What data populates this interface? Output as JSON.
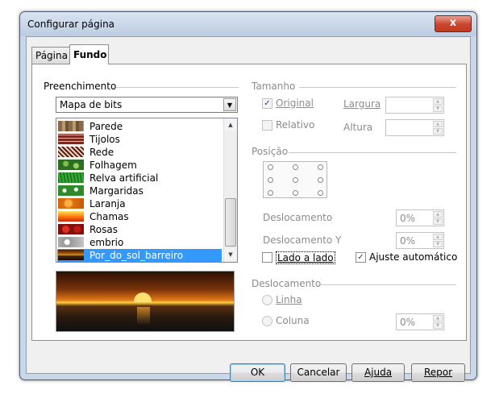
{
  "window": {
    "title": "Configurar página",
    "close_label": "x"
  },
  "tabs": [
    {
      "label": "Página",
      "active": false
    },
    {
      "label": "Fundo",
      "active": true
    }
  ],
  "fill": {
    "group_label": "Preenchimento",
    "type_selected": "Mapa de bits",
    "bitmaps": [
      {
        "name": "Parede",
        "selected": false
      },
      {
        "name": "Tijolos",
        "selected": false
      },
      {
        "name": "Rede",
        "selected": false
      },
      {
        "name": "Folhagem",
        "selected": false
      },
      {
        "name": "Relva artificial",
        "selected": false
      },
      {
        "name": "Margaridas",
        "selected": false
      },
      {
        "name": "Laranja",
        "selected": false
      },
      {
        "name": "Chamas",
        "selected": false
      },
      {
        "name": "Rosas",
        "selected": false
      },
      {
        "name": "embrio",
        "selected": false
      },
      {
        "name": "Por_do_sol_barreiro",
        "selected": true
      }
    ]
  },
  "size": {
    "group_label": "Tamanho",
    "original_label": "Original",
    "original_checked": true,
    "relative_label": "Relativo",
    "relative_checked": false,
    "width_label": "Largura",
    "height_label": "Altura"
  },
  "position": {
    "group_label": "Posição",
    "offset_x_label": "Deslocamento",
    "offset_x_value": "0%",
    "offset_y_label": "Deslocamento Y",
    "offset_y_value": "0%",
    "tile_label": "Lado a lado",
    "tile_checked": false,
    "autofit_label": "Ajuste automático",
    "autofit_checked": true
  },
  "offset": {
    "group_label": "Deslocamento",
    "row_label": "Linha",
    "column_label": "Coluna",
    "value": "0%"
  },
  "buttons": {
    "ok": "OK",
    "cancel": "Cancelar",
    "help": "Ajuda",
    "reset": "Repor"
  },
  "colors": {
    "selection": "#3399ff",
    "title_bar": "#c9d7e8",
    "close_button": "#c8452f"
  }
}
